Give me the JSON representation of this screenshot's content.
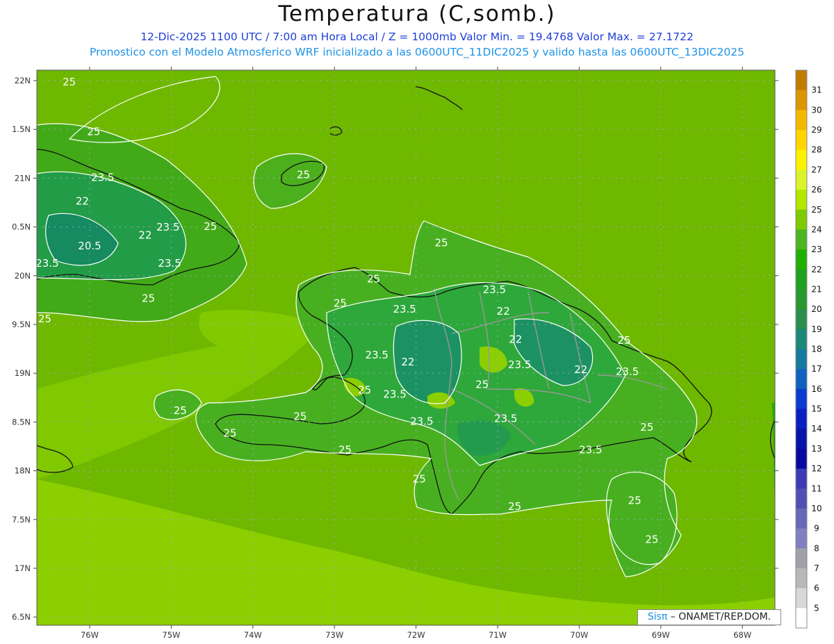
{
  "title": "Temperatura (C,somb.)",
  "subtitle_line1": "12-Dic-2025  1100 UTC / 7:00 am Hora Local / Z = 1000mb   Valor Min. = 19.4768  Valor Max. = 27.1722",
  "subtitle_line2": "Pronostico con el Modelo Atmosferico WRF inicializado a las 0600UTC_11DIC2025 y valido hasta las  0600UTC_13DIC2025",
  "credit": {
    "sis": "Sis",
    "pi": "π",
    "rest": " – ONAMET/REP.DOM."
  },
  "map": {
    "lon_ticks": [
      "76W",
      "75W",
      "74W",
      "73W",
      "72W",
      "71W",
      "70W",
      "69W",
      "68W"
    ],
    "lat_ticks": [
      "22N",
      "1.5N",
      "21N",
      "0.5N",
      "20N",
      "9.5N",
      "19N",
      "8.5N",
      "18N",
      "7.5N",
      "17N",
      "6.5N"
    ],
    "contour_labels": [
      {
        "text": "25",
        "lon": -76.25,
        "lat": 21.95
      },
      {
        "text": "25",
        "lon": -75.95,
        "lat": 21.44
      },
      {
        "text": "23.5",
        "lon": -75.84,
        "lat": 20.97
      },
      {
        "text": "22",
        "lon": -76.09,
        "lat": 20.73
      },
      {
        "text": "23.5",
        "lon": -75.04,
        "lat": 20.46
      },
      {
        "text": "22",
        "lon": -75.32,
        "lat": 20.38
      },
      {
        "text": "25",
        "lon": -74.52,
        "lat": 20.47
      },
      {
        "text": "20.5",
        "lon": -76.0,
        "lat": 20.27
      },
      {
        "text": "23.5",
        "lon": -76.52,
        "lat": 20.09
      },
      {
        "text": "23.5",
        "lon": -75.02,
        "lat": 20.09
      },
      {
        "text": "25",
        "lon": -75.28,
        "lat": 19.73
      },
      {
        "text": "25",
        "lon": -76.55,
        "lat": 19.52
      },
      {
        "text": "25",
        "lon": -73.38,
        "lat": 21.0
      },
      {
        "text": "25",
        "lon": -71.69,
        "lat": 20.3
      },
      {
        "text": "25",
        "lon": -72.52,
        "lat": 19.93
      },
      {
        "text": "25",
        "lon": -72.93,
        "lat": 19.68
      },
      {
        "text": "23.5",
        "lon": -72.14,
        "lat": 19.62
      },
      {
        "text": "23.5",
        "lon": -71.04,
        "lat": 19.82
      },
      {
        "text": "22",
        "lon": -70.93,
        "lat": 19.6
      },
      {
        "text": "22",
        "lon": -70.78,
        "lat": 19.31
      },
      {
        "text": "25",
        "lon": -69.45,
        "lat": 19.3
      },
      {
        "text": "23.5",
        "lon": -72.48,
        "lat": 19.15
      },
      {
        "text": "22",
        "lon": -72.1,
        "lat": 19.08
      },
      {
        "text": "23.5",
        "lon": -70.73,
        "lat": 19.05
      },
      {
        "text": "25",
        "lon": -71.19,
        "lat": 18.85
      },
      {
        "text": "22",
        "lon": -69.98,
        "lat": 19.0
      },
      {
        "text": "23.5",
        "lon": -69.41,
        "lat": 18.98
      },
      {
        "text": "25",
        "lon": -72.63,
        "lat": 18.79
      },
      {
        "text": "23.5",
        "lon": -72.26,
        "lat": 18.75
      },
      {
        "text": "25",
        "lon": -74.89,
        "lat": 18.58
      },
      {
        "text": "25",
        "lon": -73.42,
        "lat": 18.52
      },
      {
        "text": "23.5",
        "lon": -71.93,
        "lat": 18.47
      },
      {
        "text": "23.5",
        "lon": -70.9,
        "lat": 18.5
      },
      {
        "text": "25",
        "lon": -74.28,
        "lat": 18.35
      },
      {
        "text": "25",
        "lon": -72.87,
        "lat": 18.18
      },
      {
        "text": "25",
        "lon": -69.17,
        "lat": 18.41
      },
      {
        "text": "23.5",
        "lon": -69.86,
        "lat": 18.18
      },
      {
        "text": "25",
        "lon": -71.96,
        "lat": 17.88
      },
      {
        "text": "25",
        "lon": -69.32,
        "lat": 17.66
      },
      {
        "text": "25",
        "lon": -70.79,
        "lat": 17.6
      },
      {
        "text": "25",
        "lon": -69.11,
        "lat": 17.26
      }
    ]
  },
  "colorbar": {
    "labels": [
      "31",
      "30",
      "29",
      "28",
      "27",
      "26",
      "25",
      "24",
      "23",
      "22",
      "21",
      "20",
      "19",
      "18",
      "17",
      "16",
      "15",
      "14",
      "13",
      "12",
      "11",
      "10",
      "9",
      "8",
      "7",
      "6",
      "5"
    ],
    "colors": [
      "#c07c00",
      "#dc9500",
      "#f2b800",
      "#ffd400",
      "#fff200",
      "#dcf22a",
      "#b4e600",
      "#7eca00",
      "#4cb620",
      "#20b000",
      "#20a020",
      "#289830",
      "#2a8e4e",
      "#1e8878",
      "#1878a0",
      "#1060c0",
      "#0a3cd0",
      "#0820c0",
      "#0814a8",
      "#0808a0",
      "#3c3ab4",
      "#5050b4",
      "#6868b8",
      "#8080c0",
      "#a0a0a8",
      "#b8b8b8",
      "#d8d8d8",
      "#ffffff"
    ]
  }
}
